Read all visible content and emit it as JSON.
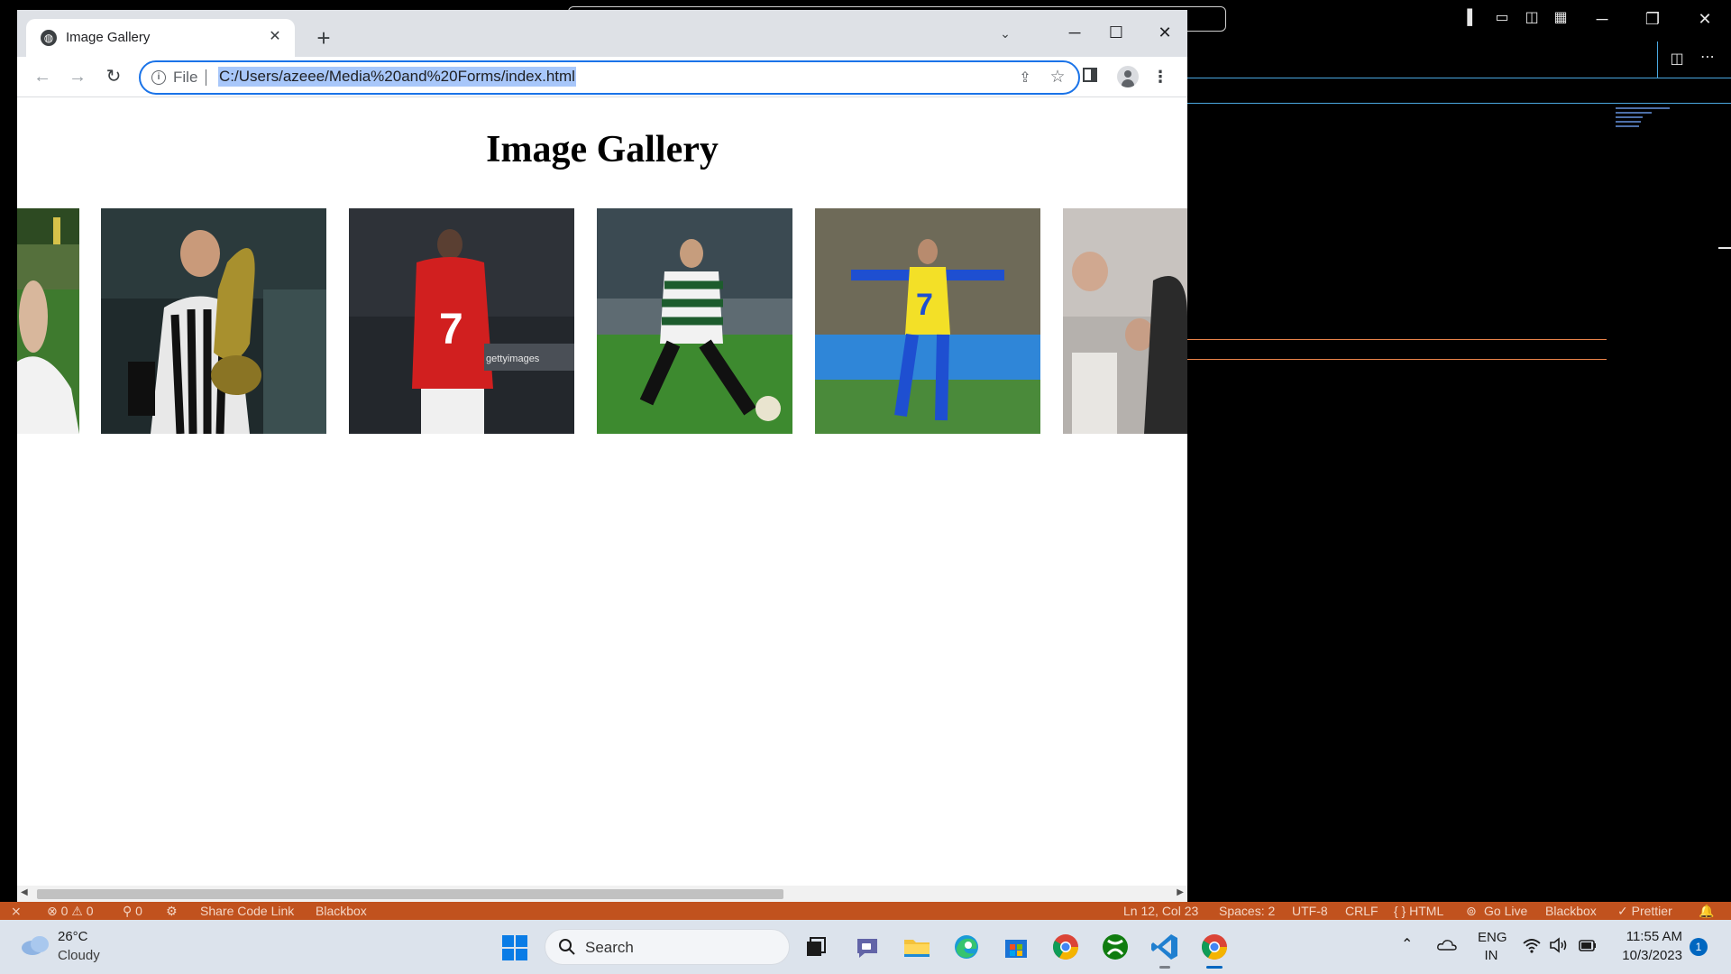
{
  "vscode": {
    "layout_icons": [
      "toggle-primary-sidebar-icon",
      "toggle-panel-icon",
      "toggle-secondary-sidebar-icon",
      "customize-layout-icon"
    ],
    "window_controls": {
      "minimize": "─",
      "restore": "❐",
      "close": "✕"
    },
    "split_icon": "◫",
    "more_icon": "⋯",
    "statusbar": {
      "remote_icon": "⨯",
      "problems": "⊗ 0 ⚠ 0",
      "ports": "⚲ 0",
      "share_code_link": "Share Code Link",
      "blackbox_left": "Blackbox",
      "cursor_position": "Ln 12, Col 23",
      "indentation": "Spaces: 2",
      "encoding": "UTF-8",
      "eol": "CRLF",
      "language": "{ } HTML",
      "go_live": "Go Live",
      "blackbox_right": "Blackbox",
      "prettier": "✓ Prettier",
      "bell_icon": "🔔"
    },
    "colors": {
      "statusbar_bg": "#c1521e",
      "accent_line": "#4aa8e0"
    }
  },
  "chrome": {
    "tab": {
      "title": "Image Gallery",
      "close": "✕",
      "globe": "◍"
    },
    "new_tab": "+",
    "tab_search": "⌄",
    "window_controls": {
      "minimize": "─",
      "maximize": "☐",
      "close": "✕"
    },
    "toolbar": {
      "back": "←",
      "forward": "→",
      "reload": "↻",
      "scheme_label": "File",
      "url": "C:/Users/azeee/Media%20and%20Forms/index.html",
      "share_icon": "⇪",
      "bookmark_icon": "☆",
      "menu_icon": "⋮"
    },
    "colors": {
      "omnibox_border": "#1a73e8",
      "url_highlight": "#a8c7fa"
    }
  },
  "page": {
    "heading": "Image Gallery",
    "images": [
      {
        "name": "player-waving-partial",
        "alt": "Player waving (partially visible)"
      },
      {
        "name": "player-holding-trophy",
        "alt": "Player holding trophy in black and white kit"
      },
      {
        "name": "player-red-number-7",
        "alt": "Player in red number 7 shirt, back view"
      },
      {
        "name": "player-striped-kit-dribbling",
        "alt": "Player in green and white stripes dribbling"
      },
      {
        "name": "player-yellow-number-7-celebrating",
        "alt": "Player in yellow number 7 shirt celebrating"
      },
      {
        "name": "player-partial-crowd",
        "alt": "Player in crowd (partially visible)"
      }
    ],
    "image_captions": {
      "gettyimages": "gettyimages"
    }
  },
  "taskbar": {
    "weather": {
      "temp": "26°C",
      "condition": "Cloudy"
    },
    "search_label": "Search",
    "apps": [
      "task-view-icon",
      "teams-chat-icon",
      "file-explorer-icon",
      "edge-icon",
      "microsoft-store-icon",
      "chrome-icon",
      "xbox-icon",
      "vscode-icon",
      "chrome-active-icon"
    ],
    "tray": {
      "chevron": "⌃",
      "lang_line1": "ENG",
      "lang_line2": "IN",
      "time": "11:55 AM",
      "date": "10/3/2023",
      "notifications": "1"
    }
  }
}
